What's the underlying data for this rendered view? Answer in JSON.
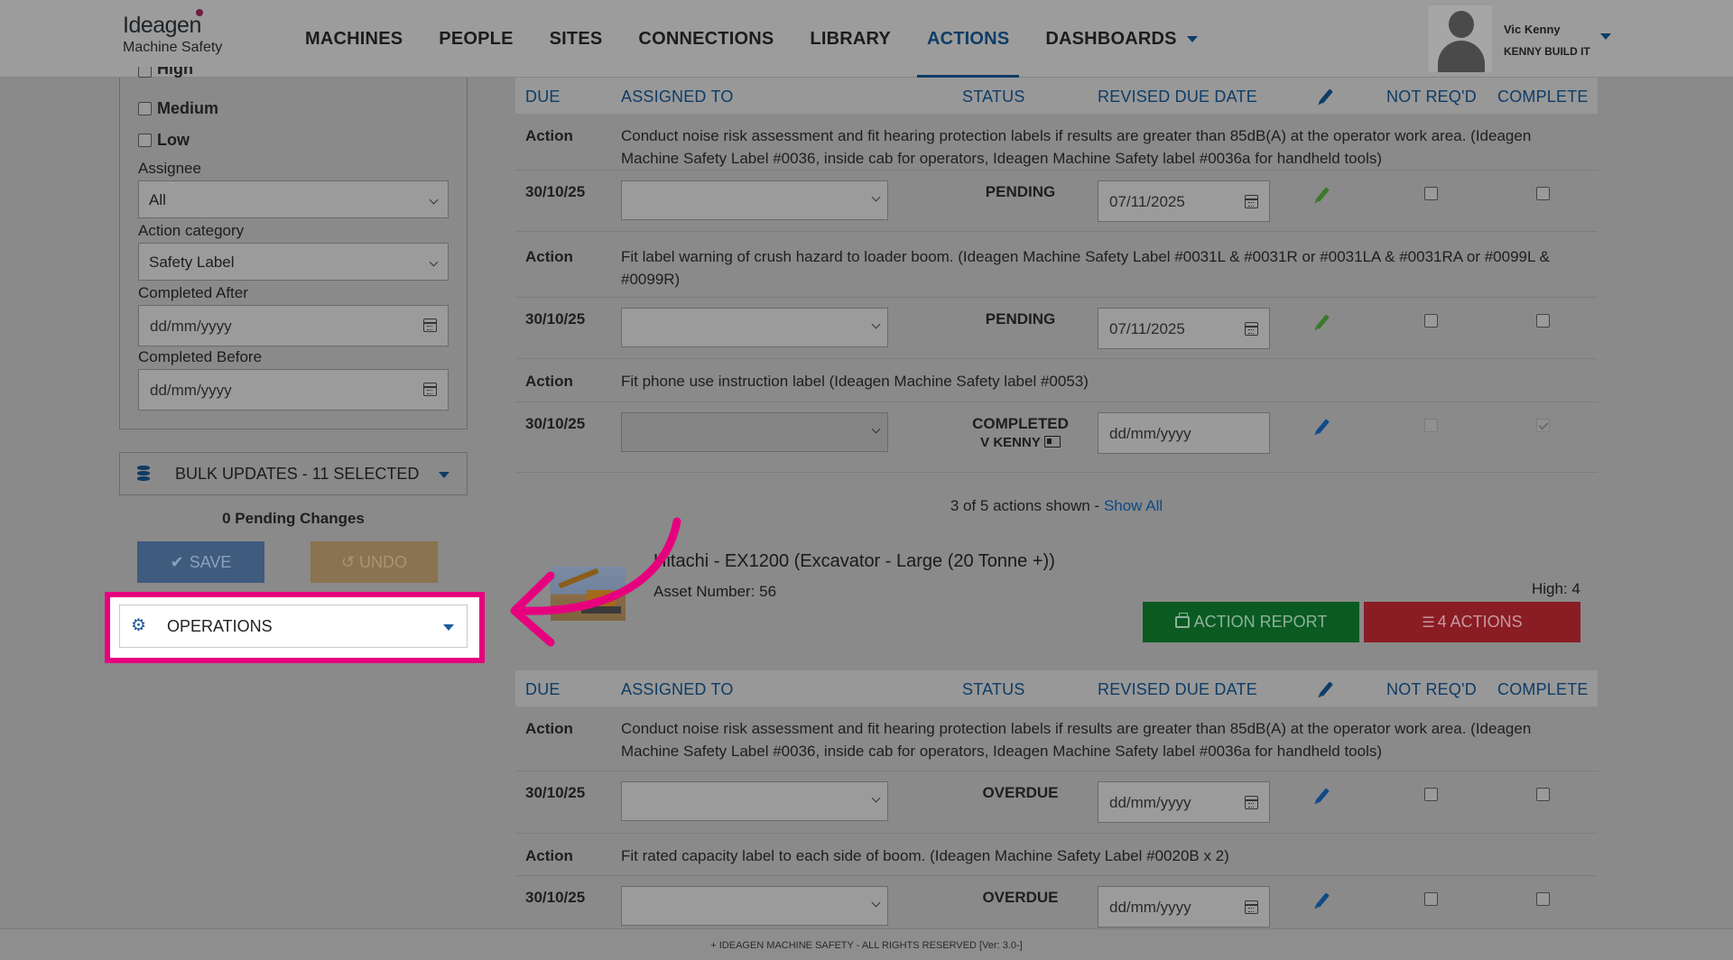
{
  "logo": {
    "brand": "Ideagen",
    "sub": "Machine Safety"
  },
  "nav": {
    "items": [
      {
        "label": "MACHINES"
      },
      {
        "label": "PEOPLE"
      },
      {
        "label": "SITES"
      },
      {
        "label": "CONNECTIONS"
      },
      {
        "label": "LIBRARY"
      },
      {
        "label": "ACTIONS"
      },
      {
        "label": "DASHBOARDS"
      }
    ],
    "active": "ACTIONS"
  },
  "user": {
    "name": "Vic Kenny",
    "company": "KENNY BUILD IT"
  },
  "filters": {
    "priority_high": "High",
    "priority_medium": "Medium",
    "priority_low": "Low",
    "assignee_label": "Assignee",
    "assignee_value": "All",
    "category_label": "Action category",
    "category_value": "Safety Label",
    "completed_after_label": "Completed After",
    "completed_after_placeholder": "dd/mm/yyyy",
    "completed_before_label": "Completed Before",
    "completed_before_placeholder": "dd/mm/yyyy"
  },
  "bulk": {
    "label": "BULK UPDATES - 11 SELECTED",
    "pending": "0 Pending Changes",
    "save": "SAVE",
    "undo": "UNDO"
  },
  "operations": {
    "label": "OPERATIONS"
  },
  "table_headers": {
    "due": "DUE",
    "assigned": "ASSIGNED TO",
    "status": "STATUS",
    "revised": "REVISED DUE DATE",
    "not_reqd": "NOT REQ'D",
    "complete": "COMPLETE"
  },
  "group1": {
    "actions": [
      {
        "label": "Action",
        "text": "Conduct noise risk assessment and fit hearing protection labels if results are greater than 85dB(A) at the operator work area. (Ideagen Machine Safety Label #0036, inside cab for operators, Ideagen Machine Safety label #0036a for handheld tools)",
        "due": "30/10/25",
        "status": "PENDING",
        "revised": "07/11/2025"
      },
      {
        "label": "Action",
        "text": "Fit label warning of crush hazard to loader boom. (Ideagen Machine Safety Label #0031L & #0031R or #0031LA & #0031RA or #0099L & #0099R)",
        "due": "30/10/25",
        "status": "PENDING",
        "revised": "07/11/2025"
      },
      {
        "label": "Action",
        "text": "Fit phone use instruction label (Ideagen Machine Safety label #0053)",
        "due": "30/10/25",
        "status": "COMPLETED",
        "completed_by": "V KENNY",
        "revised": "dd/mm/yyyy"
      }
    ],
    "shown_text": "3 of 5 actions shown - ",
    "show_all": "Show All"
  },
  "asset": {
    "title": "Hitachi - EX1200 (Excavator - Large (20 Tonne +))",
    "number": "Asset Number: 56",
    "high": "High: 4",
    "report_btn": "ACTION REPORT",
    "actions_btn": "4 ACTIONS"
  },
  "group2": {
    "actions": [
      {
        "label": "Action",
        "text": "Conduct noise risk assessment and fit hearing protection labels if results are greater than 85dB(A) at the operator work area. (Ideagen Machine Safety Label #0036, inside cab for operators, Ideagen Machine Safety label #0036a for handheld tools)",
        "due": "30/10/25",
        "status": "OVERDUE",
        "revised": "dd/mm/yyyy"
      },
      {
        "label": "Action",
        "text": "Fit rated capacity label to each side of boom. (Ideagen Machine Safety Label #0020B x 2)",
        "due": "30/10/25",
        "status": "OVERDUE",
        "revised": "dd/mm/yyyy"
      }
    ]
  },
  "footer": {
    "text": "+ IDEAGEN MACHINE SAFETY - ALL RIGHTS RESERVED   [Ver: 3.0-]"
  },
  "colors": {
    "highlight": "#e6007e",
    "brand": "#0f3c66",
    "report": "#0b5a22",
    "actions": "#8a1c24"
  }
}
